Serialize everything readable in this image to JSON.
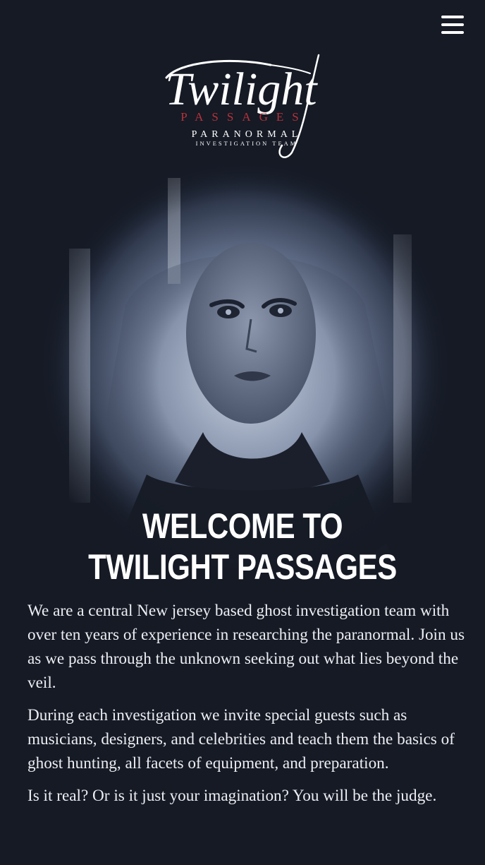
{
  "header": {
    "menu_icon": "hamburger-menu-icon",
    "logo": {
      "script_word": "Twilight",
      "caps_word": "PASSAGES",
      "line3": "PARANORMAL",
      "line4": "INVESTIGATION TEAM",
      "accent_color": "#b8323a"
    }
  },
  "hero": {
    "image": "woman-portrait-forest-vignette",
    "title_line1": "WELCOME TO",
    "title_line2": "TWILIGHT PASSAGES"
  },
  "content": {
    "paragraphs": [
      "We are a central New jersey based ghost investigation team with over ten years of experience in researching the paranormal. Join us as we pass through the unknown seeking out what lies beyond the veil.",
      "During each investigation we invite special guests such as musicians, designers, and celebrities and teach them the basics of ghost hunting, all facets of equipment, and preparation.",
      "Is it real? Or is it just your imagination? You will be the judge."
    ]
  },
  "colors": {
    "background": "#151a25",
    "text": "#ffffff",
    "logo_accent": "#b8323a"
  }
}
